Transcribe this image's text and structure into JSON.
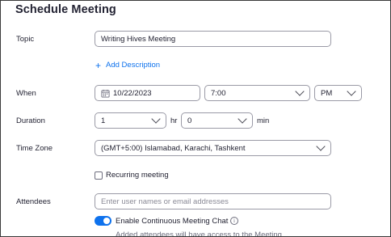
{
  "title": "Schedule Meeting",
  "topic": {
    "label": "Topic",
    "value": "Writing Hives Meeting"
  },
  "add_description": {
    "label": "Add Description"
  },
  "when": {
    "label": "When",
    "date": "10/22/2023",
    "time": "7:00",
    "ampm": "PM"
  },
  "duration": {
    "label": "Duration",
    "hours": "1",
    "hours_unit": "hr",
    "minutes": "0",
    "minutes_unit": "min"
  },
  "timezone": {
    "label": "Time Zone",
    "value": "(GMT+5:00) Islamabad, Karachi, Tashkent"
  },
  "recurring": {
    "label": "Recurring meeting",
    "checked": false
  },
  "attendees": {
    "label": "Attendees",
    "placeholder": "Enter user names or email addresses",
    "continuous_chat_label": "Enable Continuous Meeting Chat",
    "continuous_chat_enabled": true,
    "note": "Added attendees will have access to the Meeting"
  },
  "colors": {
    "accent": "#0e72ed",
    "text": "#232333",
    "border": "#9a9aa6"
  },
  "icons": {
    "add": "plus-icon",
    "date": "calendar-icon",
    "dropdown": "chevron-down-icon",
    "info": "info-icon"
  }
}
